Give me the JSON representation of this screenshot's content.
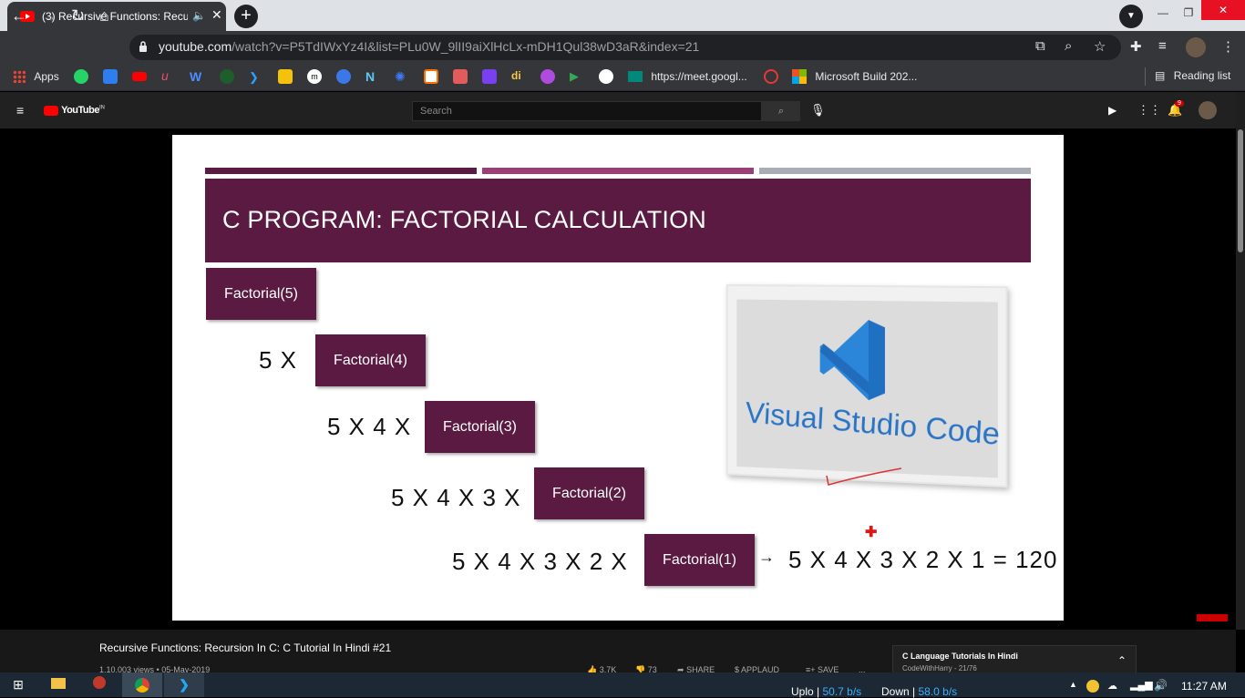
{
  "browser": {
    "tab_title": "(3) Recursive Functions: Recu",
    "tab_audio_icon": "speaker-icon",
    "tab_close": "✕",
    "new_tab": "+",
    "url_host": "youtube.com",
    "url_path": "/watch?v=P5TdIWxYz4I&list=PLu0W_9lII9aiXlHcLx-mDH1Qul38wD3aR&index=21",
    "bookmarks": [
      {
        "label": "Apps"
      },
      {
        "label": "https://meet.googl..."
      },
      {
        "label": "Microsoft Build 202..."
      }
    ],
    "reading_list": "Reading list"
  },
  "youtube": {
    "logo": "YouTube",
    "region": "IN",
    "search_placeholder": "Search",
    "notification_count": "9"
  },
  "slide": {
    "title": "C PROGRAM: FACTORIAL CALCULATION",
    "accent_colors": [
      "#5b1a42",
      "#9b3f79",
      "#a8adb5"
    ],
    "boxes": [
      "Factorial(5)",
      "Factorial(4)",
      "Factorial(3)",
      "Factorial(2)",
      "Factorial(1)"
    ],
    "prefixes": [
      "5 X",
      "5 X 4 X",
      "5 X 4 X 3 X",
      "5 X 4 X 3 X 2 X"
    ],
    "arrow": "→",
    "result": "5 X 4 X 3 X 2 X 1 = 120",
    "vscode_label": "Visual Studio Code"
  },
  "video": {
    "title": "Recursive Functions: Recursion In C: C Tutorial In Hindi #21",
    "meta": "1,10,003 views • 05-May-2019",
    "likes": "3.7K",
    "dislikes": "73",
    "share": "SHARE",
    "applaud": "APPLAUD",
    "save": "SAVE",
    "more": "..."
  },
  "playlist": {
    "title": "C Language Tutorials In Hindi",
    "channel_position": "CodeWithHarry - 21/76"
  },
  "taskbar": {
    "upload_label": "Uplo",
    "upload_value": "50.7 b/s",
    "download_label": "Down",
    "download_value": "58.0 b/s",
    "time": "11:27 AM"
  }
}
